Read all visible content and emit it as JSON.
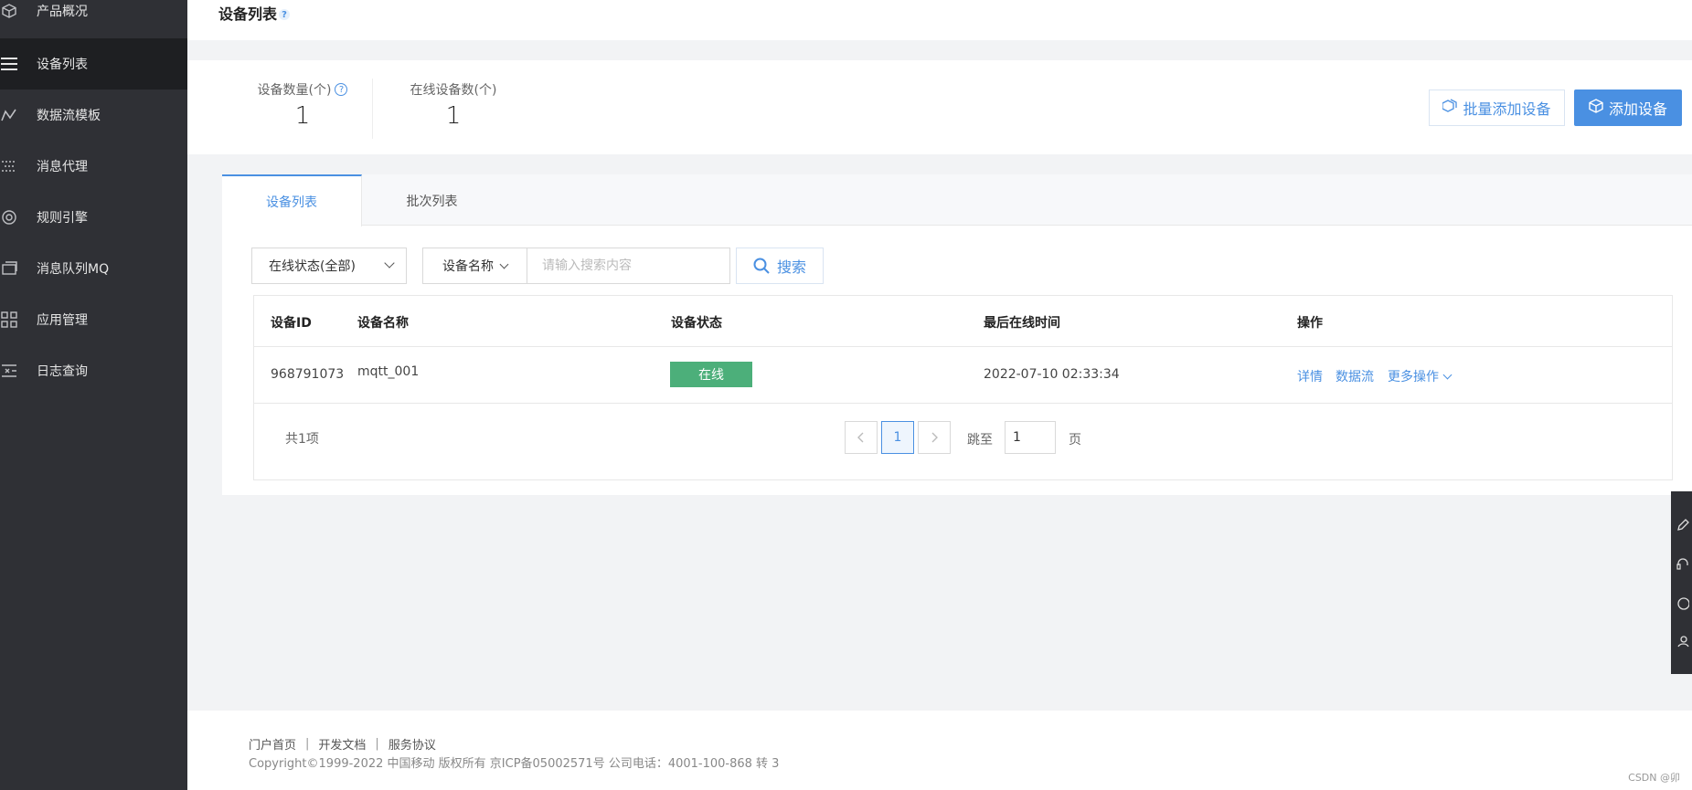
{
  "sidebar": {
    "items": [
      {
        "label": "产品概况",
        "icon": "cube-icon"
      },
      {
        "label": "设备列表",
        "icon": "list-icon"
      },
      {
        "label": "数据流模板",
        "icon": "flow-icon"
      },
      {
        "label": "消息代理",
        "icon": "proxy-icon"
      },
      {
        "label": "规则引擎",
        "icon": "engine-icon"
      },
      {
        "label": "消息队列MQ",
        "icon": "queue-icon"
      },
      {
        "label": "应用管理",
        "icon": "grid-icon"
      },
      {
        "label": "日志查询",
        "icon": "log-icon"
      }
    ]
  },
  "header": {
    "title": "设备列表",
    "help": "?"
  },
  "stats": {
    "device_count_label": "设备数量(个)",
    "device_count": "1",
    "online_count_label": "在线设备数(个)",
    "online_count": "1"
  },
  "actions": {
    "batch_add": "批量添加设备",
    "add": "添加设备"
  },
  "tabs": [
    "设备列表",
    "批次列表"
  ],
  "filters": {
    "status_select": "在线状态(全部)",
    "field_select": "设备名称",
    "search_placeholder": "请输入搜索内容",
    "search_button": "搜索"
  },
  "table": {
    "columns": [
      "设备ID",
      "设备名称",
      "设备状态",
      "最后在线时间",
      "操作"
    ],
    "rows": [
      {
        "id": "968791073",
        "name": "mqtt_001",
        "status": "在线",
        "last_online": "2022-07-10 02:33:34",
        "ops": [
          "详情",
          "数据流",
          "更多操作"
        ]
      }
    ]
  },
  "pagination": {
    "total": "共1项",
    "current_page": "1",
    "jump_label": "跳至",
    "jump_value": "1",
    "page_suffix": "页"
  },
  "footer": {
    "links": [
      "门户首页",
      "开发文档",
      "服务协议"
    ],
    "copyright": "Copyright©1999-2022 中国移动 版权所有 京ICP备05002571号 公司电话：4001-100-868 转 3",
    "watermark": "CSDN @卯"
  },
  "colors": {
    "accent": "#4a90e2",
    "sidebar_bg": "#2f3035",
    "online": "#4caf7a"
  }
}
